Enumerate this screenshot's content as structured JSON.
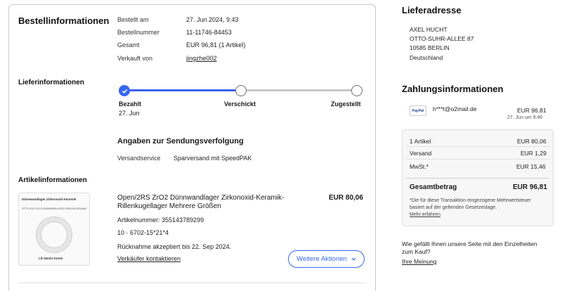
{
  "order": {
    "title": "Bestellinformationen",
    "rows": [
      {
        "label": "Bestellt am",
        "value": "27. Jun 2024, 9:43"
      },
      {
        "label": "Bestellnummer",
        "value": "11-11746-84453"
      },
      {
        "label": "Gesamt",
        "value": "EUR 96,81 (1 Artikel)"
      },
      {
        "label": "Verkauft von",
        "value": "jingzhe002"
      }
    ]
  },
  "delivery": {
    "title": "Lieferinformationen",
    "progress": 0.5,
    "steps": [
      {
        "label": "Bezahlt",
        "date": "27. Jun",
        "done": true
      },
      {
        "label": "Verschickt",
        "date": "",
        "done": false
      },
      {
        "label": "Zugestellt",
        "date": "",
        "done": false
      }
    ],
    "tracking_title": "Angaben zur Sendungsverfolgung",
    "service_label": "Versandservice",
    "service_value": "Sparversand mit SpeedPAK"
  },
  "items": {
    "title": "Artikelinformationen",
    "thumb_text": [
      "Dünnwandlager Zirkonoxid-Keramik",
      "OTTO-6702 ZrO2 DÜNNWANDLAGER ZIRKON-KERAMIK",
      "Lß-16mm-21mm"
    ],
    "product_title_line1": "Open/2RS ZrO2 Dünnwandlager Zirkonoxid-Keramik-",
    "product_title_line2": "Rillenkugellager Mehrere Größen",
    "price": "EUR 80,06",
    "article_number": "Artikelnummer: 355143789299",
    "variant": "10 · 6702-15*21*4",
    "return_note": "Rücknahme akzeptiert bis 22. Sep 2024.",
    "contact_link": "Verkäufer kontaktieren",
    "more_actions": "Weitere Aktionen"
  },
  "address": {
    "title": "Lieferadresse",
    "lines": [
      "AXEL HUCHT",
      "OTTO-SUHR-ALLEE 87",
      "10585 BERLIN",
      "Deutschland"
    ]
  },
  "payment": {
    "title": "Zahlungsinformationen",
    "paypal_logo": "PayPal",
    "email": "h***t@o2mail.de",
    "amount": "EUR 96,81",
    "date": "27. Jun um 9:46",
    "rows": [
      {
        "label": "1 Artikel",
        "value": "EUR 80,06"
      },
      {
        "label": "Versand",
        "value": "EUR 1,29"
      },
      {
        "label": "MwSt.*",
        "value": "EUR 15,46"
      }
    ],
    "total_label": "Gesamtbetrag",
    "total_value": "EUR 96,81",
    "note_line1": "*Die für diese Transaktion eingezogene Mehrwertsteuer",
    "note_line2": "basiert auf der geltenden Gesetzeslage.",
    "note_link": "Mehr erfahren"
  },
  "feedback": {
    "question_line1": "Wie gefällt Ihnen unsere Seite mit den Einzelheiten",
    "question_line2": "zum Kauf?",
    "link": "Ihre Meinung"
  },
  "colors": {
    "accent": "#3665f3",
    "border": "#c8c8c8"
  }
}
